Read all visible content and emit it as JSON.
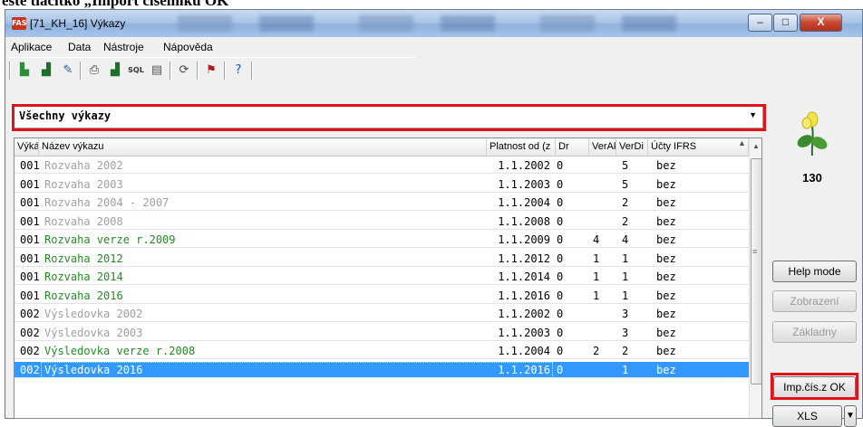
{
  "caption_partial": "este tlačítko „Import číselníků OK",
  "window": {
    "title": "[71_KH_16] Výkazy",
    "app_icon_label": "FAS",
    "minimize": "–",
    "maximize": "□",
    "close": "X"
  },
  "menu": [
    "Aplikace",
    "Data",
    "Nástroje",
    "Nápověda"
  ],
  "toolbar_icons": [
    "new-report-icon",
    "export-icon",
    "edit-icon",
    "print-icon",
    "export2-icon",
    "sql-icon",
    "table-icon",
    "refresh-icon",
    "flag-exit-icon",
    "help-icon"
  ],
  "filter": {
    "selected": "Všechny výkazy"
  },
  "grid": {
    "columns": [
      "Výkáz",
      "Název výkazu",
      "Platnost od (z",
      "Dr",
      "VerAk",
      "VerDi",
      "Účty IFRS"
    ],
    "rows": [
      {
        "code": "001",
        "name": "Rozvaha 2002",
        "valid_from": "1.1.2002",
        "dr": "0",
        "verak": "",
        "verdi": "5",
        "ifrs": "bez",
        "style": "gray"
      },
      {
        "code": "001",
        "name": "Rozvaha 2003",
        "valid_from": "1.1.2003",
        "dr": "0",
        "verak": "",
        "verdi": "5",
        "ifrs": "bez",
        "style": "gray"
      },
      {
        "code": "001",
        "name": "Rozvaha 2004 - 2007",
        "valid_from": "1.1.2004",
        "dr": "0",
        "verak": "",
        "verdi": "2",
        "ifrs": "bez",
        "style": "gray"
      },
      {
        "code": "001",
        "name": "Rozvaha 2008",
        "valid_from": "1.1.2008",
        "dr": "0",
        "verak": "",
        "verdi": "2",
        "ifrs": "bez",
        "style": "gray"
      },
      {
        "code": "001",
        "name": "Rozvaha verze r.2009",
        "valid_from": "1.1.2009",
        "dr": "0",
        "verak": "4",
        "verdi": "4",
        "ifrs": "bez",
        "style": "green"
      },
      {
        "code": "001",
        "name": "Rozvaha 2012",
        "valid_from": "1.1.2012",
        "dr": "0",
        "verak": "1",
        "verdi": "1",
        "ifrs": "bez",
        "style": "green"
      },
      {
        "code": "001",
        "name": "Rozvaha 2014",
        "valid_from": "1.1.2014",
        "dr": "0",
        "verak": "1",
        "verdi": "1",
        "ifrs": "bez",
        "style": "green"
      },
      {
        "code": "001",
        "name": "Rozvaha 2016",
        "valid_from": "1.1.2016",
        "dr": "0",
        "verak": "1",
        "verdi": "1",
        "ifrs": "bez",
        "style": "green"
      },
      {
        "code": "002",
        "name": "Výsledovka 2002",
        "valid_from": "1.1.2002",
        "dr": "0",
        "verak": "",
        "verdi": "3",
        "ifrs": "bez",
        "style": "gray"
      },
      {
        "code": "002",
        "name": "Výsledovka 2003",
        "valid_from": "1.1.2003",
        "dr": "0",
        "verak": "",
        "verdi": "3",
        "ifrs": "bez",
        "style": "gray"
      },
      {
        "code": "002",
        "name": "Výsledovka verze r.2008",
        "valid_from": "1.1.2004",
        "dr": "0",
        "verak": "2",
        "verdi": "2",
        "ifrs": "bez",
        "style": "green"
      },
      {
        "code": "002",
        "name": "Výsledovka 2016",
        "valid_from": "1.1.2016",
        "dr": "0",
        "verak": "",
        "verdi": "1",
        "ifrs": "bez",
        "style": "selected"
      }
    ]
  },
  "side": {
    "count": "130",
    "help_mode": "Help mode",
    "zobrazeni": "Zobrazení",
    "zakladny": "Základny",
    "imp": "Imp.čís.z OK",
    "xls": "XLS",
    "dd": "▼"
  },
  "colors": {
    "selection": "#3399ff",
    "highlight_box": "#e0131a",
    "active_text": "#228b22",
    "inactive_text": "#a0a0a0"
  }
}
